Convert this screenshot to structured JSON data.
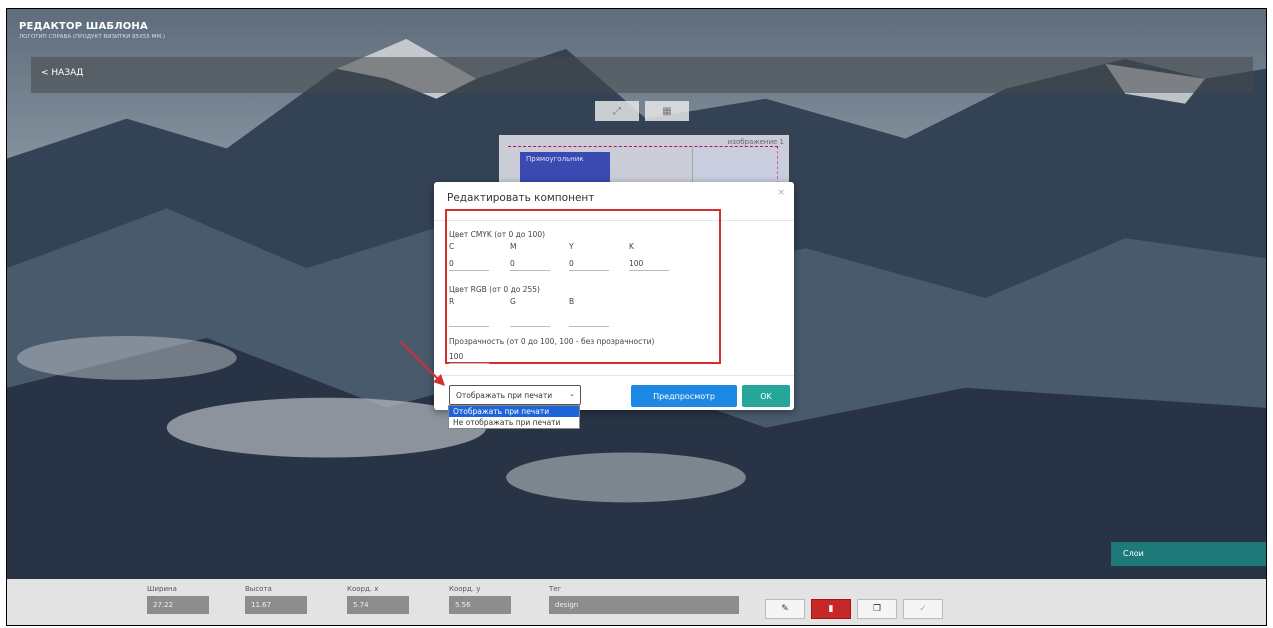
{
  "header": {
    "title": "РЕДАКТОР ШАБЛОНА",
    "subtitle": "ЛОГОТИП СПРАВА (ПРОДУКТ ВИЗИТКИ 85Х55 ММ.)"
  },
  "back_label": "< НАЗАД",
  "canvas": {
    "rect_label": "Прямоугольник",
    "image_label": "изображение 1"
  },
  "modal": {
    "title": "Редактировать компонент",
    "close": "×",
    "cmyk_label": "Цвет CMYK (от 0 до 100)",
    "cmyk_channels": [
      "C",
      "M",
      "Y",
      "K"
    ],
    "cmyk_values": [
      "0",
      "0",
      "0",
      "100"
    ],
    "rgb_label": "Цвет RGB (от 0 до 255)",
    "rgb_channels": [
      "R",
      "G",
      "B"
    ],
    "rgb_values": [
      "",
      "",
      ""
    ],
    "opacity_label": "Прозрачность (от 0 до 100, 100 - без прозрачности)",
    "opacity_value": "100",
    "print_select": {
      "selected": "Отображать при печати",
      "options": [
        "Отображать при печати",
        "Не отображать при печати"
      ]
    },
    "preview_button": "Предпросмотр",
    "ok_button": "OK"
  },
  "layers_label": "Слои",
  "bottom": {
    "width_label": "Ширина",
    "width_value": "27.22",
    "height_label": "Высота",
    "height_value": "11.67",
    "x_label": "Коорд. x",
    "x_value": "5.74",
    "y_label": "Коорд. y",
    "y_value": "5.56",
    "tag_label": "Тег",
    "tag_value": "design"
  },
  "icons": [
    "pencil-icon",
    "trash-icon",
    "copy-icon",
    "check-icon",
    "expand-icon",
    "qr-icon",
    "chevron-down-icon",
    "arrow-annotation-icon"
  ],
  "colors": {
    "accent_blue": "#1e88e5",
    "ok_green": "#26a69a",
    "delete_red": "#c62828",
    "highlight_red": "#d32f2f",
    "layers_teal": "#1d7a78"
  }
}
